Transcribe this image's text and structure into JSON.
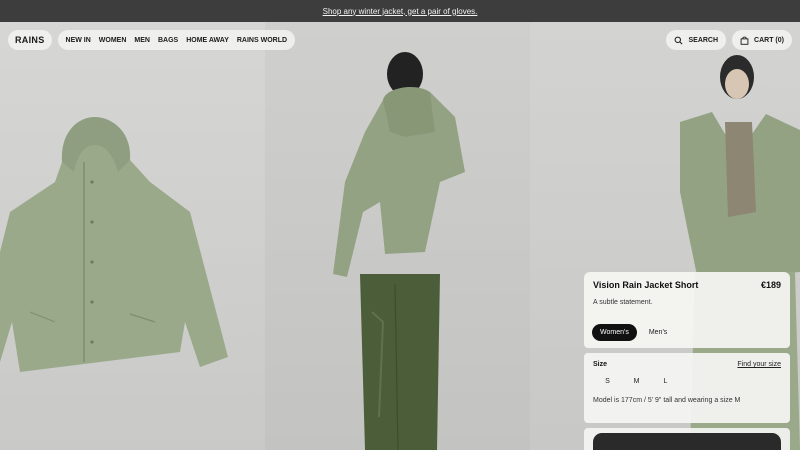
{
  "announcement": {
    "text": "Shop any winter jacket, get a pair of gloves."
  },
  "header": {
    "logo": "RAINS",
    "menu": [
      "NEW IN",
      "WOMEN",
      "MEN",
      "BAGS",
      "HOME AWAY",
      "RAINS WORLD"
    ],
    "search_label": "SEARCH",
    "cart_label": "CART (0)"
  },
  "product": {
    "name": "Vision Rain Jacket Short",
    "price": "€189",
    "tagline": "A subtle statement.",
    "genders": [
      "Women's",
      "Men's"
    ],
    "size_label": "Size",
    "size_guide": "Find your size",
    "sizes": [
      "S",
      "M",
      "L"
    ],
    "model_info": "Model is 177cm / 5' 9\" tall and wearing a size M"
  },
  "colors": {
    "jacket": "#9aa98a",
    "pants": "#4c5d3a",
    "bar": "#3d3d3d"
  },
  "icons": {
    "search": "search-icon",
    "cart": "bag-icon"
  }
}
